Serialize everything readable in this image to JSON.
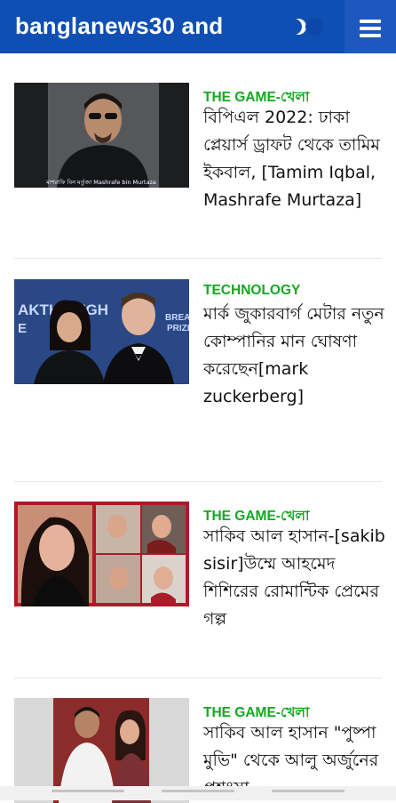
{
  "header": {
    "site_title": "banglanews30 and",
    "theme_icon": "moon-icon",
    "menu_icon": "hamburger-menu-icon",
    "colors": {
      "bar": "#0f4fb4",
      "menu_bg": "#1c58bd"
    }
  },
  "articles": [
    {
      "category": "THE GAME-খেলা",
      "title": "বিপিএল 2022: ঢাকা প্লেয়ার্স ড্রাফট থেকে তামিম ইকবাল, [Tamim Iqbal, Mashrafe Murtaza]",
      "thumb_caption": "মাশরাফি বিন মর্তুজা Mashrafe bin Murtaza"
    },
    {
      "category": "TECHNOLOGY",
      "title": "মার্ক জুকারবার্গ মেটার নতুন কোম্পানির মান ঘোষণা করেছেন[mark zuckerberg]",
      "thumb_text_left": "AKTHR UGH",
      "thumb_text_left2": "E",
      "thumb_text_right": "BREAK",
      "thumb_text_right2": "PRIZE"
    },
    {
      "category": "THE GAME-খেলা",
      "title": "সাকিব আল হাসান-[sakib sisir]উম্মে আহমেদ শিশিরের রোমান্টিক প্রেমের গল্প"
    },
    {
      "category": "THE GAME-খেলা",
      "title": "সাকিব আল হাসান \"পুষ্পা মুভি\" থেকে আলু অর্জুনের প্রশংসা"
    }
  ],
  "accent_color": "#14a821"
}
